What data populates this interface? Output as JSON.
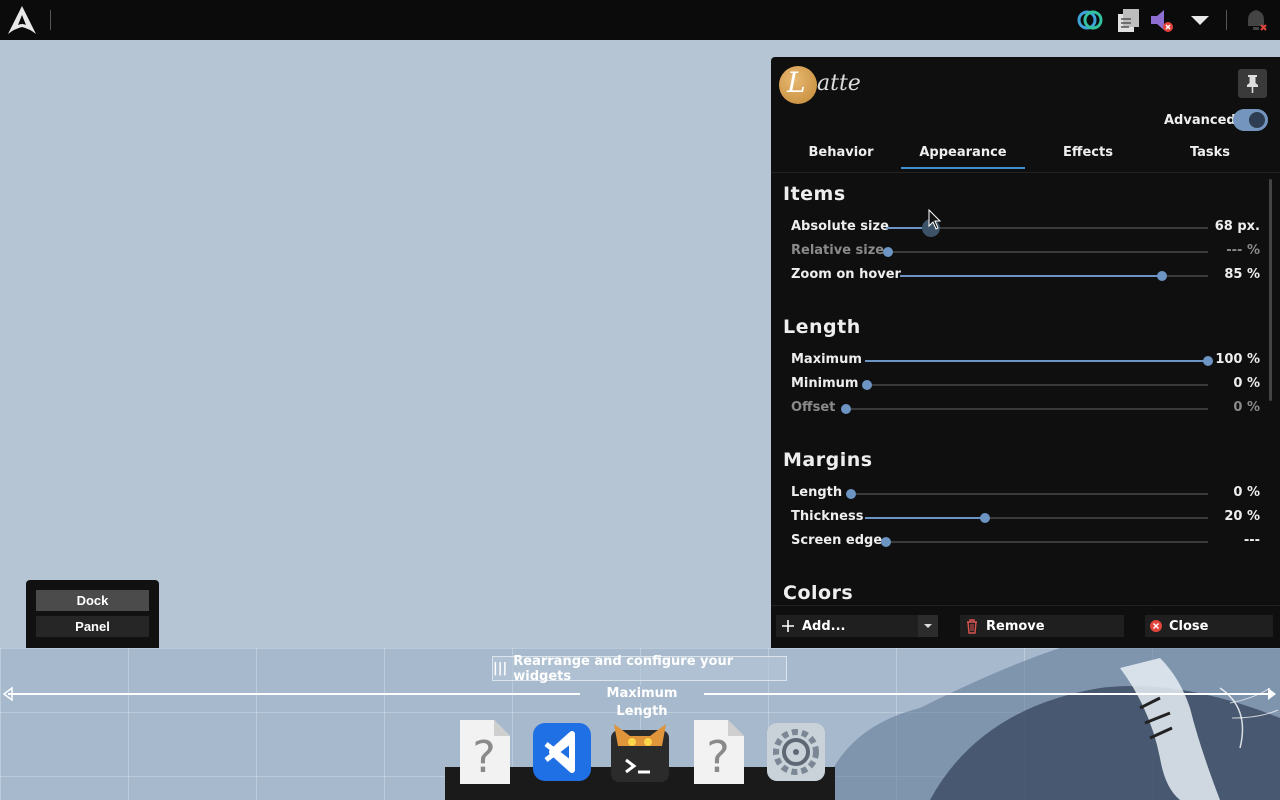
{
  "latte": {
    "name": "atte",
    "logo_letter": "L"
  },
  "header": {
    "advanced_label": "Advanced",
    "advanced_on": true
  },
  "tabs": [
    {
      "label": "Behavior",
      "active": false
    },
    {
      "label": "Appearance",
      "active": true
    },
    {
      "label": "Effects",
      "active": false
    },
    {
      "label": "Tasks",
      "active": false
    }
  ],
  "sections": {
    "items": {
      "title": "Items",
      "rows": [
        {
          "label": "Absolute size",
          "value": "68 px.",
          "level": 0.14,
          "enabled": true
        },
        {
          "label": "Relative size",
          "value": "--- %",
          "level": 0.0,
          "enabled": false
        },
        {
          "label": "Zoom on hover",
          "value": "85 %",
          "level": 0.85,
          "enabled": true
        }
      ]
    },
    "length": {
      "title": "Length",
      "rows": [
        {
          "label": "Maximum",
          "value": "100 %",
          "level": 1.0,
          "enabled": true
        },
        {
          "label": "Minimum",
          "value": "0 %",
          "level": 0.0,
          "enabled": true
        },
        {
          "label": "Offset",
          "value": "0 %",
          "level": 0.0,
          "enabled": false
        }
      ]
    },
    "margins": {
      "title": "Margins",
      "rows": [
        {
          "label": "Length",
          "value": "0 %",
          "level": 0.0,
          "enabled": true
        },
        {
          "label": "Thickness",
          "value": "20 %",
          "level": 0.35,
          "enabled": true
        },
        {
          "label": "Screen edge",
          "value": "---",
          "level": 0.0,
          "enabled": true
        }
      ]
    },
    "colors": {
      "title": "Colors"
    }
  },
  "footer": {
    "add_label": "Add...",
    "remove_label": "Remove",
    "close_label": "Close"
  },
  "view_type": {
    "dock_label": "Dock",
    "panel_label": "Panel",
    "selected": "Dock"
  },
  "edit_mode": {
    "rearrange_label": "Rearrange and configure your widgets",
    "max_length_label": "Maximum Length"
  },
  "dock_apps": [
    {
      "icon": "unknown-file-icon"
    },
    {
      "icon": "vscode-icon"
    },
    {
      "icon": "terminal-cat-icon"
    },
    {
      "icon": "unknown-file-icon"
    },
    {
      "icon": "system-settings-icon"
    }
  ],
  "tray_icons": [
    "kde-connect-icon",
    "clipboard-icon",
    "volume-muted-icon",
    "expand-tray-icon",
    "notifications-icon"
  ],
  "colors": {
    "accent": "#6c95c4",
    "tab_underline": "#3f8fd2",
    "remove_icon": "#d9534f",
    "close_icon": "#e0443b"
  }
}
